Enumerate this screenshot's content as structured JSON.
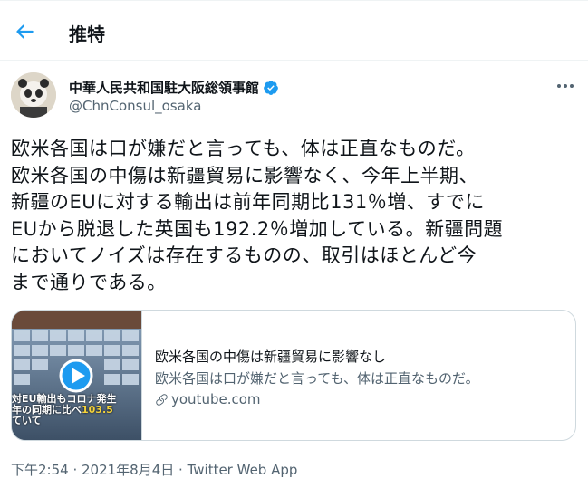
{
  "header": {
    "title": "推特"
  },
  "account": {
    "name": "中華人民共和国駐大阪総領事館",
    "handle": "@ChnConsul_osaka"
  },
  "tweet": {
    "text": "欧米各国は口が嫌だと言っても、体は正直なものだ。\n欧米各国の中傷は新疆貿易に影響なく、今年上半期、\n新疆のEUに対する輸出は前年同期比131％増、すでに\nEUから脱退した英国も192.2％増加している。新疆問題\nにおいてノイズは存在するものの、取引はほとんど今\nまで通りである。"
  },
  "card": {
    "title": "欧米各国の中傷は新疆貿易に影響なし",
    "description": "欧米各国は口が嫌だと言っても、体は正直なものだ。",
    "domain": "youtube.com",
    "thumbnail_text": {
      "line1": "対EU輸出もコロナ発生",
      "line2": "年の同期に比べ",
      "highlight": "103.5",
      "line3": "ていて"
    }
  },
  "meta": {
    "time": "下午2:54",
    "separator1": " · ",
    "date": "2021年8月4日",
    "separator2": " · ",
    "source": "Twitter Web App"
  },
  "colors": {
    "accent": "#1d9bf0",
    "text": "#0f1419",
    "secondary": "#536471",
    "border": "#cfd9de",
    "thumb_highlight": "#f5d33a"
  },
  "icons": {
    "back": "arrow-left-icon",
    "verified": "verified-badge-icon",
    "more": "more-horizontal-icon",
    "play": "play-icon",
    "link": "link-icon"
  }
}
